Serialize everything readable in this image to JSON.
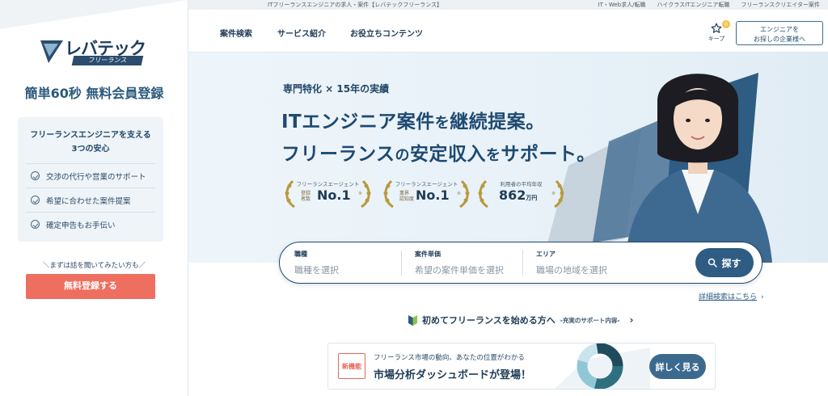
{
  "sidebar": {
    "logo_word": "レバテック",
    "logo_sub": "フリーランス",
    "signup_heading": "簡単60秒 無料会員登録",
    "benefits_title_line1": "フリーランスエンジニアを支える",
    "benefits_title_line2": "3つの安心",
    "benefits": [
      "交渉の代行や営業のサポート",
      "希望に合わせた案件提案",
      "確定申告もお手伝い"
    ],
    "pre_cta": "＼まずは話を聞いてみたい方も／",
    "cta_label": "無料登録する"
  },
  "utility": {
    "title": "ITフリーランスエンジニアの求人・案件【レバテックフリーランス】",
    "links": [
      "IT・Web求人/転職",
      "ハイクラスITエンジニア転職",
      "フリーランスクリエイター案件"
    ]
  },
  "header": {
    "nav": [
      "案件検索",
      "サービス紹介",
      "お役立ちコンテンツ"
    ],
    "keep_label": "キープ",
    "keep_count": "0",
    "client_button_line1": "エンジニアを",
    "client_button_line2": "お探しの企業様へ"
  },
  "hero": {
    "subtitle": "専門特化 × 15年の実績",
    "line1_a": "ITエンジニア案件",
    "line1_b": "を",
    "line1_c": "継続提案。",
    "line2_a": "フリーランス",
    "line2_b": "の",
    "line2_c": "安定収入",
    "line2_d": "を",
    "line2_e": "サポート。",
    "awards": [
      {
        "top": "フリーランスエージェント",
        "side1": "登録",
        "side2": "者数",
        "big": "No.1",
        "unit": "",
        "note": "※"
      },
      {
        "top": "フリーランスエージェント",
        "side1": "業界",
        "side2": "認知度",
        "big": "No.1",
        "unit": "",
        "note": "※"
      },
      {
        "top": "利用者の平均年収",
        "side1": "",
        "side2": "",
        "big": "862",
        "unit": "万円",
        "note": "※"
      }
    ]
  },
  "search": {
    "fields": [
      {
        "label": "職種",
        "placeholder": "職種を選択"
      },
      {
        "label": "案件単価",
        "placeholder": "希望の案件単価を選択"
      },
      {
        "label": "エリア",
        "placeholder": "職場の地域を選択"
      }
    ],
    "button_label": "探す"
  },
  "links": {
    "advanced": "詳細検索はこちら",
    "intro": "初めてフリーランスを始める方へ",
    "intro_sub": "-充実のサポート内容-"
  },
  "banner": {
    "badge": "新機能",
    "sub": "フリーランス市場の動向、あなたの位置がわかる",
    "main": "市場分析ダッシュボードが登場！",
    "button_label": "詳しく見る"
  },
  "colors": {
    "brand_navy": "#1f3b57",
    "accent_blue": "#2e5c82",
    "cta_coral": "#ee6e5f"
  }
}
